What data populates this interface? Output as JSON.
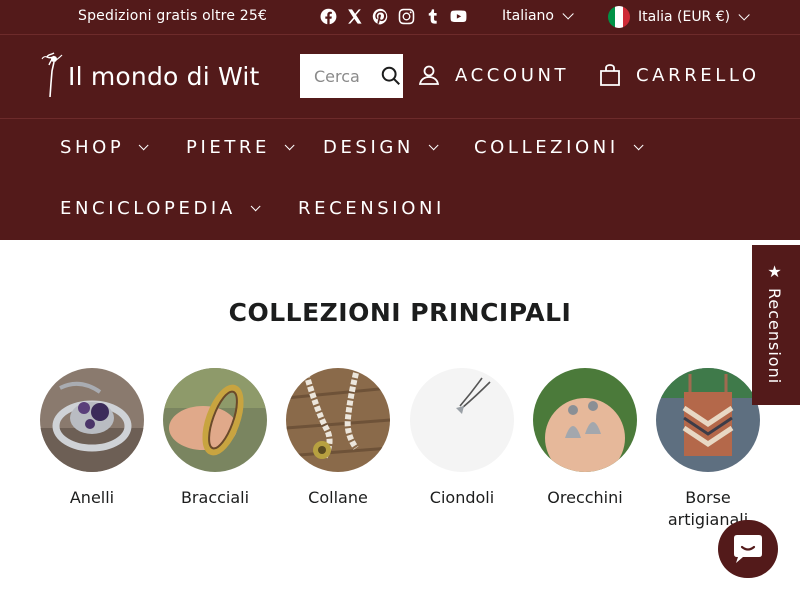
{
  "topbar": {
    "promo": "Spedizioni gratis oltre 25€",
    "social": [
      "facebook-icon",
      "x-icon",
      "pinterest-icon",
      "instagram-icon",
      "tumblr-icon",
      "youtube-icon"
    ],
    "language": "Italiano",
    "currency": "Italia (EUR €)"
  },
  "header": {
    "logo_text": "Il mondo di Wit",
    "search_placeholder": "Cerca",
    "account_label": "ACCOUNT",
    "cart_label": "CARRELLO"
  },
  "nav": {
    "items": [
      {
        "label": "SHOP"
      },
      {
        "label": "PIETRE"
      },
      {
        "label": "DESIGN"
      },
      {
        "label": "COLLEZIONI"
      },
      {
        "label": "ENCICLOPEDIA"
      },
      {
        "label": "RECENSIONI"
      }
    ]
  },
  "collections": {
    "title": "COLLEZIONI PRINCIPALI",
    "items": [
      {
        "label": "Anelli"
      },
      {
        "label": "Bracciali"
      },
      {
        "label": "Collane"
      },
      {
        "label": "Ciondoli"
      },
      {
        "label": "Orecchini"
      },
      {
        "label": "Borse artigianali"
      }
    ]
  },
  "reviews_tab": {
    "star": "★",
    "label": "Recensioni"
  },
  "colors": {
    "brand": "#531a1a",
    "text": "#1c1d1d",
    "background": "#ffffff"
  }
}
